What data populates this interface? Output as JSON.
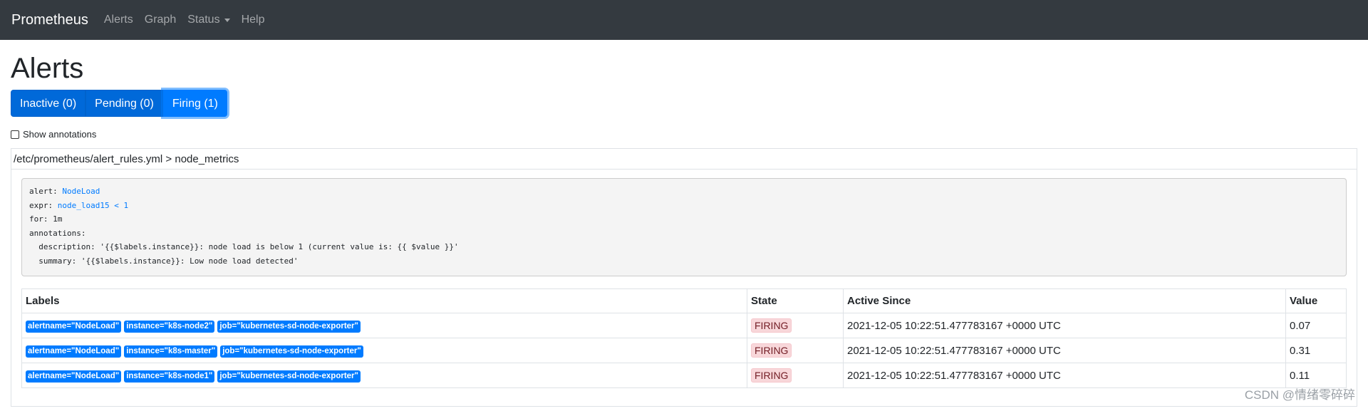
{
  "navbar": {
    "brand": "Prometheus",
    "links": [
      "Alerts",
      "Graph",
      "Status",
      "Help"
    ]
  },
  "page": {
    "title": "Alerts",
    "filters": [
      "Inactive (0)",
      "Pending (0)",
      "Firing (1)"
    ],
    "active_filter": "Firing (1)",
    "show_annotations_label": "Show annotations"
  },
  "group": {
    "header": "/etc/prometheus/alert_rules.yml > node_metrics",
    "rule": {
      "alert_key": "alert:",
      "alert_value": "NodeLoad",
      "expr_key": "expr:",
      "expr_value": "node_load15 < 1",
      "for_line": "for: 1m",
      "annotations_line": "annotations:",
      "description_line": "  description: '{{$labels.instance}}: node load is below 1 (current value is: {{ $value }}'",
      "summary_line": "  summary: '{{$labels.instance}}: Low node load detected'"
    },
    "table": {
      "headers": [
        "Labels",
        "State",
        "Active Since",
        "Value"
      ],
      "rows": [
        {
          "labels": [
            "alertname=\"NodeLoad\"",
            "instance=\"k8s-node2\"",
            "job=\"kubernetes-sd-node-exporter\""
          ],
          "state": "FIRING",
          "active_since": "2021-12-05 10:22:51.477783167 +0000 UTC",
          "value": "0.07"
        },
        {
          "labels": [
            "alertname=\"NodeLoad\"",
            "instance=\"k8s-master\"",
            "job=\"kubernetes-sd-node-exporter\""
          ],
          "state": "FIRING",
          "active_since": "2021-12-05 10:22:51.477783167 +0000 UTC",
          "value": "0.31"
        },
        {
          "labels": [
            "alertname=\"NodeLoad\"",
            "instance=\"k8s-node1\"",
            "job=\"kubernetes-sd-node-exporter\""
          ],
          "state": "FIRING",
          "active_since": "2021-12-05 10:22:51.477783167 +0000 UTC",
          "value": "0.11"
        }
      ]
    }
  },
  "watermark": "CSDN @情绪零碎碎",
  "colors": {
    "navbar_bg": "#343a40",
    "primary": "#007bff",
    "firing_bg": "#f8d7da"
  }
}
